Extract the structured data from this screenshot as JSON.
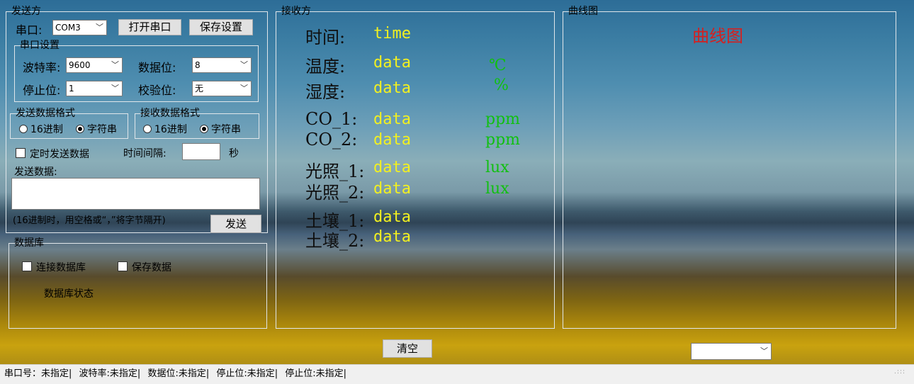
{
  "sender": {
    "title": "发送方",
    "port_label": "串口:",
    "port_value": "COM3",
    "open_port_button": "打开串口",
    "save_settings_button": "保存设置",
    "port_settings": {
      "title": "串口设置",
      "baud_label": "波特率:",
      "baud_value": "9600",
      "data_bits_label": "数据位:",
      "data_bits_value": "8",
      "stop_bits_label": "停止位:",
      "stop_bits_value": "1",
      "parity_label": "校验位:",
      "parity_value": "无"
    },
    "send_format": {
      "title": "发送数据格式",
      "hex": "16进制",
      "string": "字符串",
      "selected": "string"
    },
    "recv_format": {
      "title": "接收数据格式",
      "hex": "16进制",
      "string": "字符串",
      "selected": "string"
    },
    "timed_send_label": "定时发送数据",
    "interval_label": "时间间隔:",
    "interval_value": "",
    "seconds_label": "秒",
    "send_data_label": "发送数据:",
    "send_data_value": "",
    "hint": "(16进制时，用空格或“，”将字节隔开)",
    "send_button": "发送"
  },
  "database": {
    "title": "数据库",
    "connect_label": "连接数据库",
    "save_label": "保存数据",
    "status_label": "数据库状态"
  },
  "receiver": {
    "title": "接收方",
    "rows": [
      {
        "label": "时间:",
        "value": "time",
        "unit": ""
      },
      {
        "label": "温度:",
        "value": "data",
        "unit": "℃"
      },
      {
        "label": "湿度:",
        "value": "data",
        "unit": "%"
      },
      {
        "label": "CO_1:",
        "value": "data",
        "unit": "ppm"
      },
      {
        "label": "CO_2:",
        "value": "data",
        "unit": "ppm"
      },
      {
        "label": "光照_1:",
        "value": "data",
        "unit": "lux"
      },
      {
        "label": "光照_2:",
        "value": "data",
        "unit": "lux"
      },
      {
        "label": "土壤_1:",
        "value": "data",
        "unit": ""
      },
      {
        "label": "土壤_2:",
        "value": "data",
        "unit": ""
      }
    ],
    "clear_button": "清空"
  },
  "chart_panel": {
    "title": "曲线图",
    "chart_title": "曲线图",
    "chart_title_color": "#d42020",
    "select_value": ""
  },
  "status": {
    "port": "串口号：未指定|",
    "baud": "波特率:未指定|",
    "data_bits": "数据位:未指定|",
    "stop_bits": "停止位:未指定|",
    "stop_bits_2": "停止位:未指定|"
  },
  "colors": {
    "value_yellow": "#f2f020",
    "unit_green": "#10c010"
  }
}
